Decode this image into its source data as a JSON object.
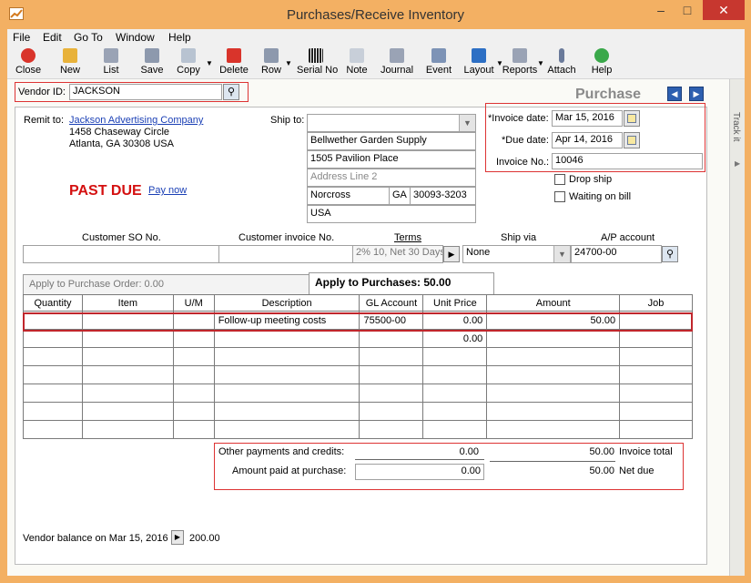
{
  "window": {
    "title": "Purchases/Receive Inventory"
  },
  "menu": [
    "File",
    "Edit",
    "Go To",
    "Window",
    "Help"
  ],
  "toolbar": [
    {
      "label": "Close",
      "icon": "close-icon",
      "color": "#d9342b"
    },
    {
      "label": "New",
      "icon": "new-icon",
      "color": "#e8b23a"
    },
    {
      "label": "List",
      "icon": "list-icon",
      "color": "#9aa3b5"
    },
    {
      "label": "Save",
      "icon": "save-icon",
      "color": "#8d99ad"
    },
    {
      "label": "Copy",
      "icon": "copy-icon",
      "color": "#b8c3d1"
    },
    {
      "label": "Delete",
      "icon": "delete-icon",
      "color": "#d9342b"
    },
    {
      "label": "Row",
      "icon": "row-icon",
      "color": "#8d99ad"
    },
    {
      "label": "Serial No",
      "icon": "barcode-icon",
      "color": "#444444"
    },
    {
      "label": "Note",
      "icon": "note-icon",
      "color": "#c8cfd9"
    },
    {
      "label": "Journal",
      "icon": "journal-icon",
      "color": "#9aa3b5"
    },
    {
      "label": "Event",
      "icon": "event-icon",
      "color": "#7d93b6"
    },
    {
      "label": "Layout",
      "icon": "layout-icon",
      "color": "#2d6fc4"
    },
    {
      "label": "Reports",
      "icon": "reports-icon",
      "color": "#9aa3b5"
    },
    {
      "label": "Attach",
      "icon": "attach-icon",
      "color": "#6a7a9a"
    },
    {
      "label": "Help",
      "icon": "help-icon",
      "color": "#3aa84a"
    }
  ],
  "vendor": {
    "label": "Vendor ID:",
    "value": "JACKSON"
  },
  "purchase_label": "Purchase",
  "side_tab": "Track it",
  "remit": {
    "label": "Remit to:",
    "name": "Jackson Advertising Company",
    "line1": "1458 Chaseway Circle",
    "line2": "Atlanta, GA 30308 USA"
  },
  "ship": {
    "label": "Ship to:",
    "value": "",
    "name": "Bellwether Garden Supply",
    "addr1": "1505 Pavilion Place",
    "addr2": "Address Line 2",
    "city": "Norcross",
    "state": "GA",
    "zip": "30093-3203",
    "country": "USA"
  },
  "invoice": {
    "date_label": "*Invoice date:",
    "date": "Mar 15, 2016",
    "due_label": "*Due date:",
    "due": "Apr 14, 2016",
    "no_label": "Invoice No.:",
    "no": "10046"
  },
  "checks": {
    "drop_ship": "Drop ship",
    "waiting": "Waiting on bill"
  },
  "past_due": {
    "text": "PAST DUE",
    "pay_now": "Pay now"
  },
  "fields": {
    "customer_so": {
      "label": "Customer SO No.",
      "value": ""
    },
    "customer_invoice": {
      "label": "Customer invoice No.",
      "value": ""
    },
    "terms": {
      "label": "Terms",
      "value": "2% 10, Net 30 Days"
    },
    "ship_via": {
      "label": "Ship via",
      "value": "None"
    },
    "ap_account": {
      "label": "A/P account",
      "value": "24700-00"
    }
  },
  "tabs": {
    "order": "Apply to Purchase Order: 0.00",
    "purchases": "Apply to Purchases: 50.00"
  },
  "grid": {
    "headers": [
      "Quantity",
      "Item",
      "U/M",
      "Description",
      "GL Account",
      "Unit Price",
      "Amount",
      "Job"
    ],
    "rows": [
      [
        "",
        "",
        "",
        "Follow-up meeting costs",
        "75500-00",
        "0.00",
        "50.00",
        ""
      ],
      [
        "",
        "",
        "",
        "",
        "",
        "0.00",
        "",
        ""
      ],
      [
        "",
        "",
        "",
        "",
        "",
        "",
        "",
        ""
      ],
      [
        "",
        "",
        "",
        "",
        "",
        "",
        "",
        ""
      ],
      [
        "",
        "",
        "",
        "",
        "",
        "",
        "",
        ""
      ],
      [
        "",
        "",
        "",
        "",
        "",
        "",
        "",
        ""
      ],
      [
        "",
        "",
        "",
        "",
        "",
        "",
        "",
        ""
      ]
    ]
  },
  "totals": {
    "other_label": "Other payments and credits:",
    "other_value": "0.00",
    "invoice_total": "50.00",
    "invoice_total_label": "Invoice total",
    "paid_label": "Amount paid at purchase:",
    "paid_value": "0.00",
    "net_due": "50.00",
    "net_due_label": "Net due"
  },
  "balance": {
    "label": "Vendor balance on Mar 15, 2016",
    "value": "200.00"
  }
}
